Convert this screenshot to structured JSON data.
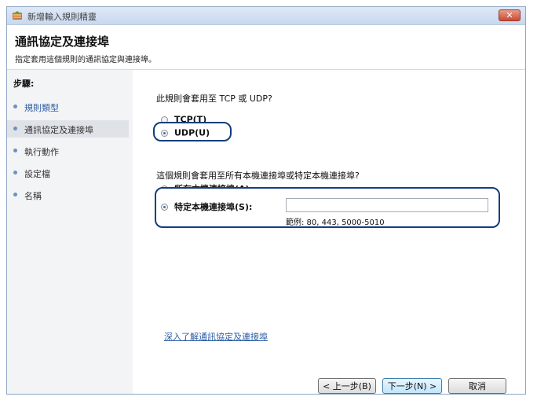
{
  "window": {
    "title": "新增輸入規則精靈",
    "close_label": "✕"
  },
  "header": {
    "title": "通訊協定及連接埠",
    "subtitle": "指定套用這個規則的通訊協定與連接埠。"
  },
  "steps": {
    "title": "步驟:",
    "items": [
      {
        "label": "規則類型",
        "state": "link"
      },
      {
        "label": "通訊協定及連接埠",
        "state": "current"
      },
      {
        "label": "執行動作",
        "state": "normal"
      },
      {
        "label": "設定檔",
        "state": "normal"
      },
      {
        "label": "名稱",
        "state": "normal"
      }
    ]
  },
  "protocol": {
    "question": "此規則會套用至 TCP 或 UDP?",
    "tcp_label": "TCP(T)",
    "udp_label": "UDP(U)",
    "selected": "UDP"
  },
  "ports": {
    "question": "這個規則會套用至所有本機連接埠或特定本機連接埠?",
    "all_label": "所有本機連接埠(A)",
    "specific_label": "特定本機連接埠(S):",
    "specific_value": "",
    "example": "範例: 80, 443, 5000-5010",
    "selected": "specific"
  },
  "learn_more": "深入了解通訊協定及連接埠",
  "buttons": {
    "back": "< 上一步(B)",
    "next": "下一步(N) >",
    "cancel": "取消"
  },
  "colors": {
    "highlight_border": "#123e7d",
    "link": "#2d5da4",
    "step_current_bg": "#dfe3e8"
  }
}
